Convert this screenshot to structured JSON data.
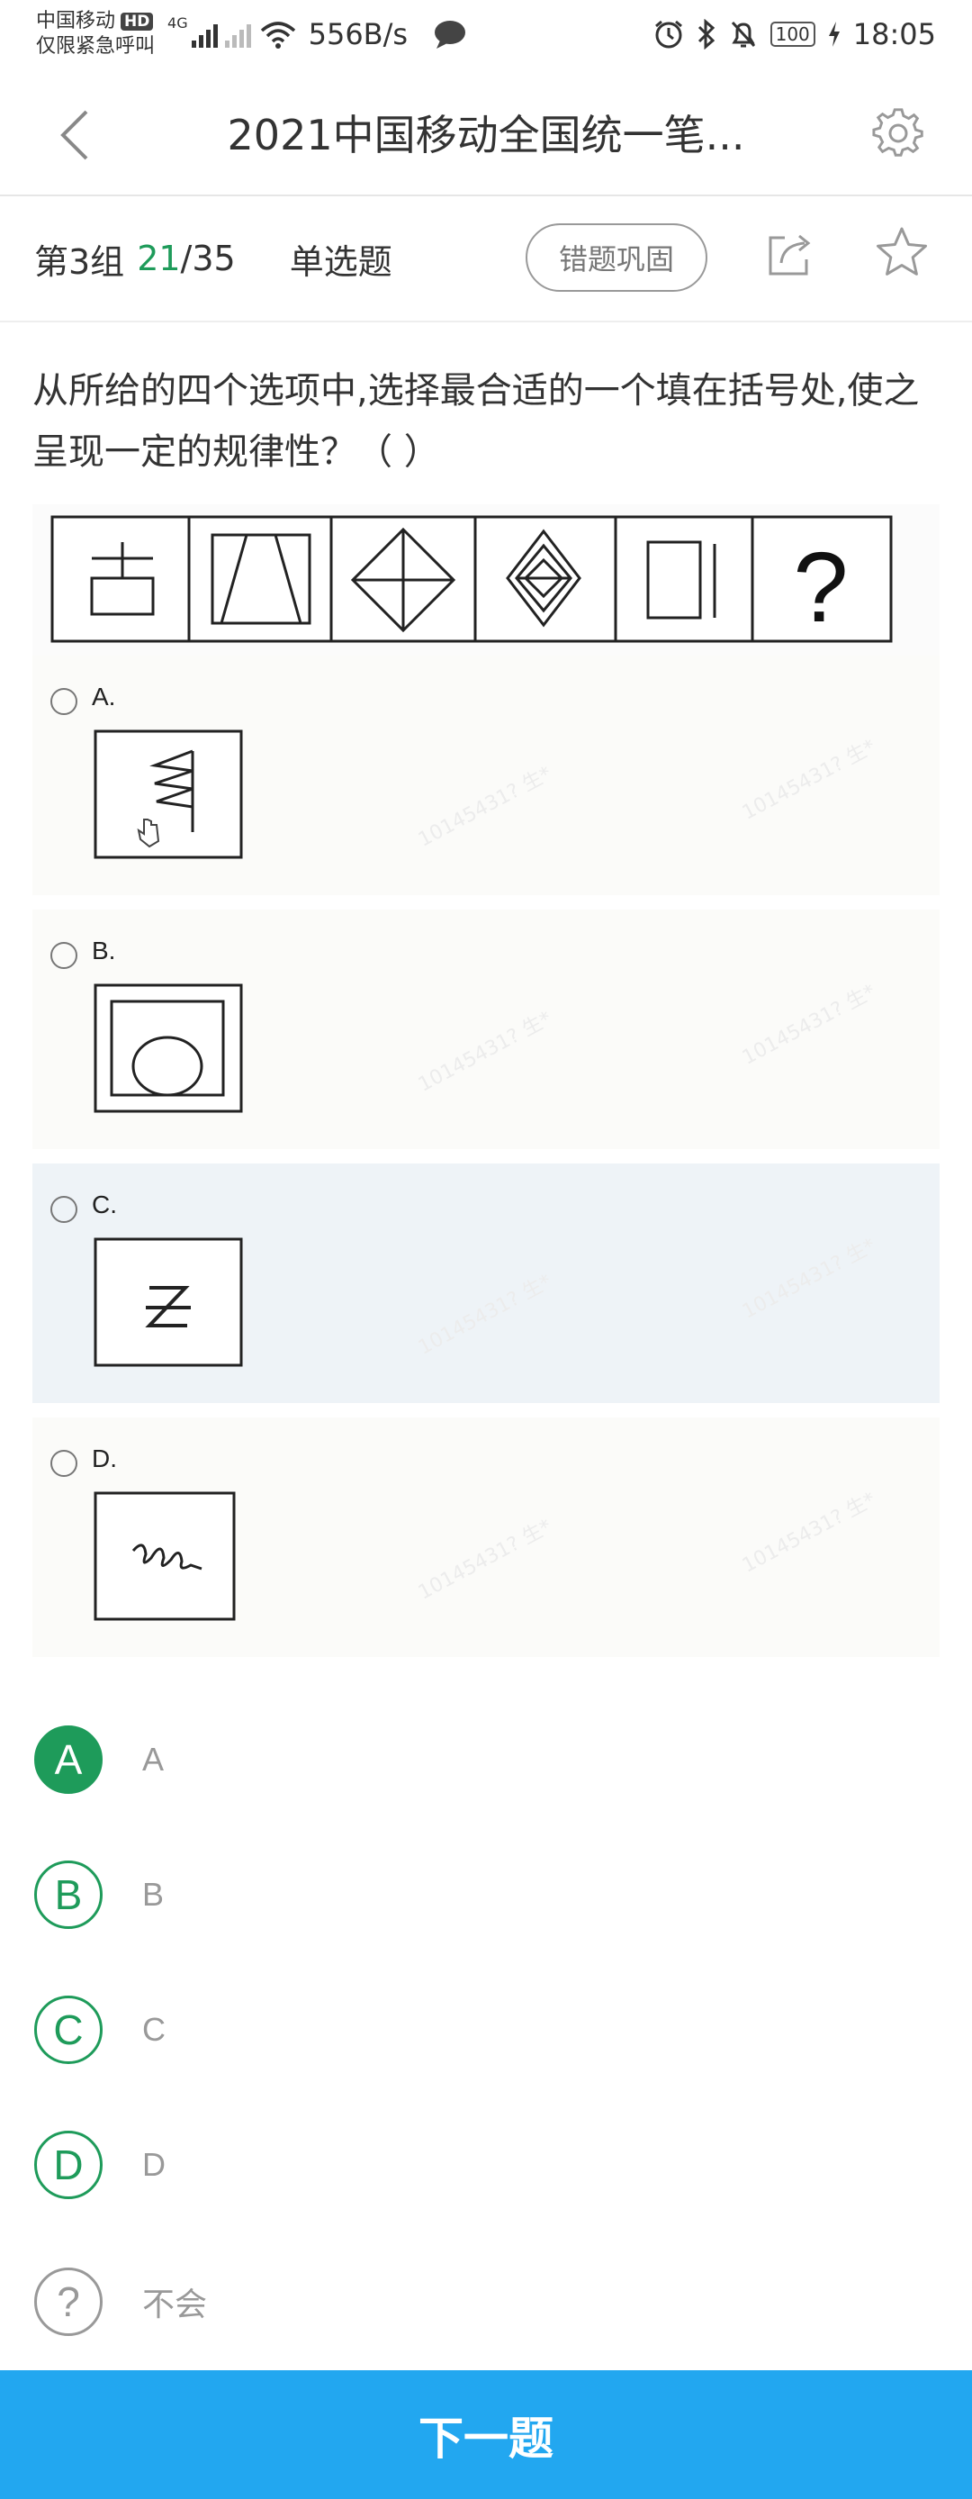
{
  "status_bar": {
    "carrier": "中国移动",
    "hd_badge": "HD",
    "emergency": "仅限紧急呼叫",
    "net_type": "4G",
    "speed": "556B/s",
    "battery": "100",
    "time": "18:05"
  },
  "header": {
    "title": "2021中国移动全国统一笔..."
  },
  "info": {
    "group": "第3组",
    "current": "21",
    "total": "/35",
    "type": "单选题",
    "review_button": "错题巩固"
  },
  "question": {
    "text": "从所给的四个选项中,选择最合适的一个填在括号处,使之呈现一定的规律性？（ ）"
  },
  "options": [
    {
      "label": "A.",
      "selected": false
    },
    {
      "label": "B.",
      "selected": false
    },
    {
      "label": "C.",
      "selected": true
    },
    {
      "label": "D.",
      "selected": false
    }
  ],
  "watermark": "10145431? 生*",
  "answers": [
    {
      "letter": "A",
      "text": "A",
      "style": "filled"
    },
    {
      "letter": "B",
      "text": "B",
      "style": "outline"
    },
    {
      "letter": "C",
      "text": "C",
      "style": "outline"
    },
    {
      "letter": "D",
      "text": "D",
      "style": "outline"
    },
    {
      "letter": "?",
      "text": "不会",
      "style": "gray"
    }
  ],
  "next_button": "下一题",
  "colors": {
    "accent_green": "#1e9b5a",
    "next_blue": "#22a7f0",
    "selected_option_bg": "#eef3f7"
  }
}
